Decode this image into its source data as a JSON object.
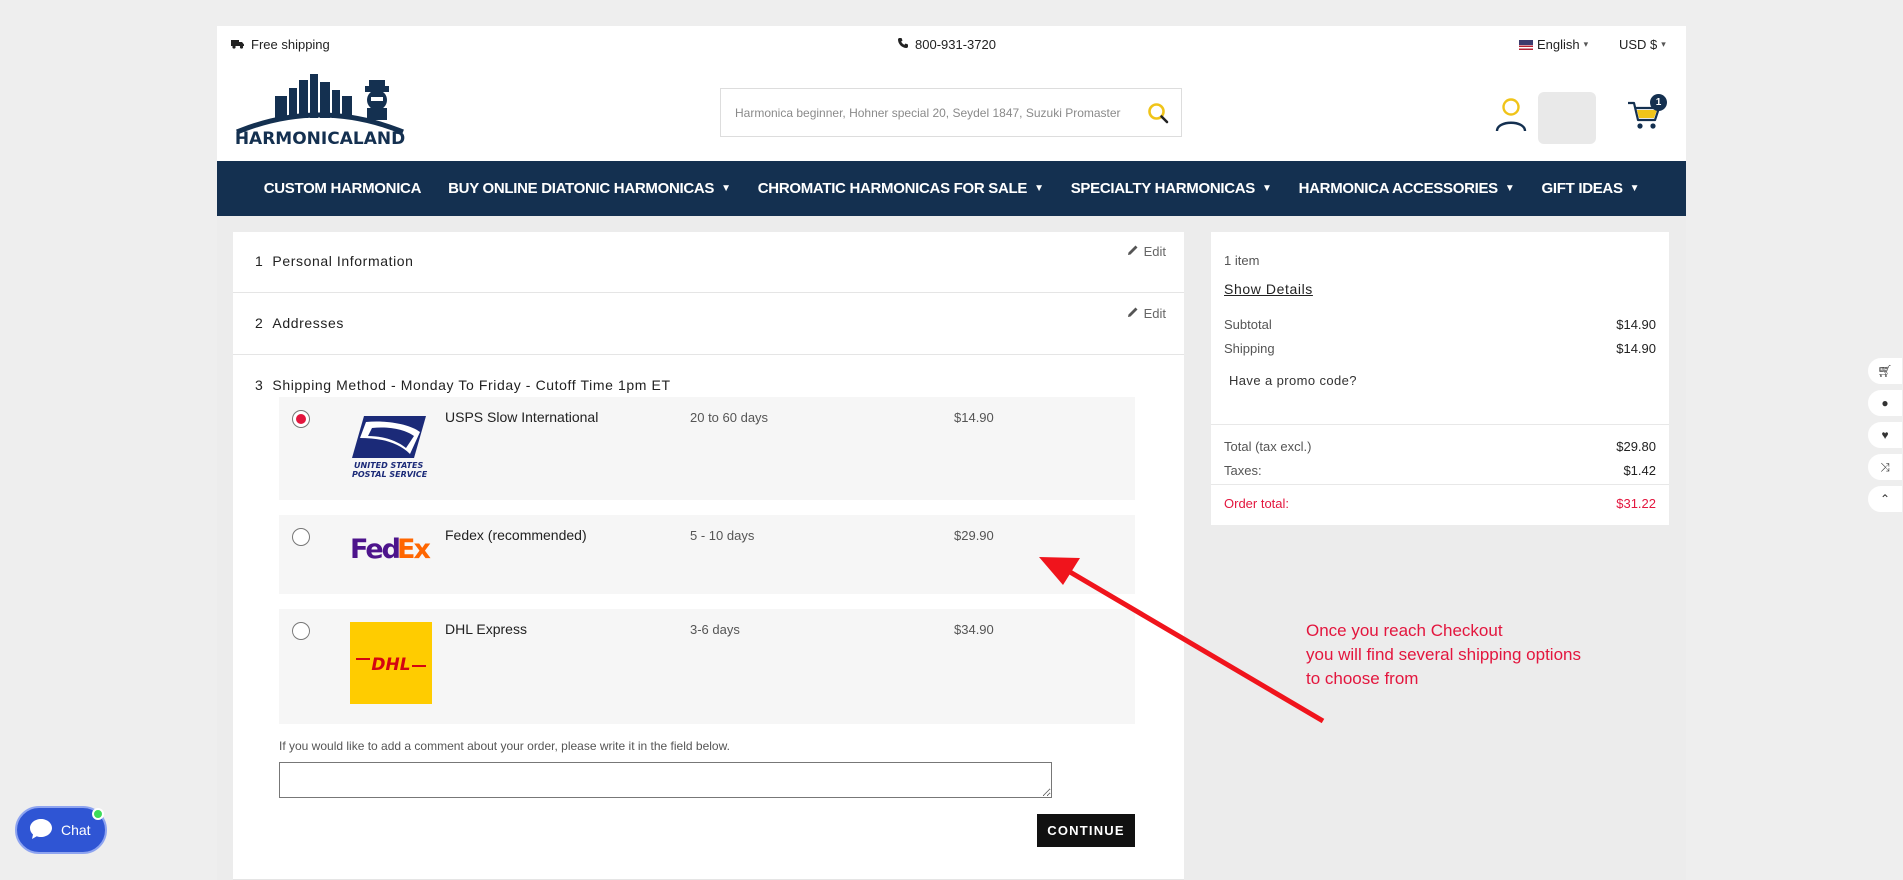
{
  "topbar": {
    "shipping": "Free shipping",
    "phone": "800-931-3720",
    "language": "English",
    "currency": "USD $"
  },
  "logo": {
    "text": "HARMONICALAND"
  },
  "search": {
    "placeholder": "Harmonica beginner, Hohner special 20, Seydel 1847, Suzuki Promaster"
  },
  "cart": {
    "count": "1"
  },
  "nav": [
    {
      "label": "CUSTOM HARMONICA",
      "dropdown": false
    },
    {
      "label": "BUY ONLINE DIATONIC HARMONICAS",
      "dropdown": true
    },
    {
      "label": "CHROMATIC HARMONICAS FOR SALE",
      "dropdown": true
    },
    {
      "label": "SPECIALTY HARMONICAS",
      "dropdown": true
    },
    {
      "label": "HARMONICA ACCESSORIES",
      "dropdown": true
    },
    {
      "label": "GIFT IDEAS",
      "dropdown": true
    }
  ],
  "checkout": {
    "steps": [
      {
        "number": "1",
        "title": "Personal Information",
        "edit": "Edit"
      },
      {
        "number": "2",
        "title": "Addresses",
        "edit": "Edit"
      },
      {
        "number": "3",
        "title": "Shipping Method - Monday To Friday - Cutoff Time 1pm ET"
      }
    ],
    "shipping_options": [
      {
        "name": "USPS Slow International",
        "days": "20 to 60 days",
        "price": "$14.90",
        "selected": true,
        "logo": "usps-logo"
      },
      {
        "name": "Fedex (recommended)",
        "days": "5 - 10 days",
        "price": "$29.90",
        "selected": false,
        "logo": "fedex-logo"
      },
      {
        "name": "DHL Express",
        "days": "3-6 days",
        "price": "$34.90",
        "selected": false,
        "logo": "dhl-logo"
      }
    ],
    "comment_label": "If you would like to add a comment about your order, please write it in the field below.",
    "continue_label": "CONTINUE"
  },
  "summary": {
    "item_count": "1 item",
    "show_details": "Show Details",
    "subtotal_label": "Subtotal",
    "subtotal": "$14.90",
    "shipping_label": "Shipping",
    "shipping": "$14.90",
    "promo": "Have a promo code?",
    "total_excl_label": "Total (tax excl.)",
    "total_excl": "$29.80",
    "taxes_label": "Taxes:",
    "taxes": "$1.42",
    "order_total_label": "Order total:",
    "order_total": "$31.22"
  },
  "annotation": {
    "line1": "Once you reach Checkout",
    "line2": "you will find several shipping options",
    "line3": "to choose from"
  },
  "chat": {
    "label": "Chat"
  },
  "colors": {
    "nav_bg": "#143050",
    "accent_red": "#e3163e",
    "search_icon": "#f0c419",
    "dhl_yellow": "#ffcc00",
    "fedex_purple": "#4d148c",
    "fedex_orange": "#ff6600"
  }
}
